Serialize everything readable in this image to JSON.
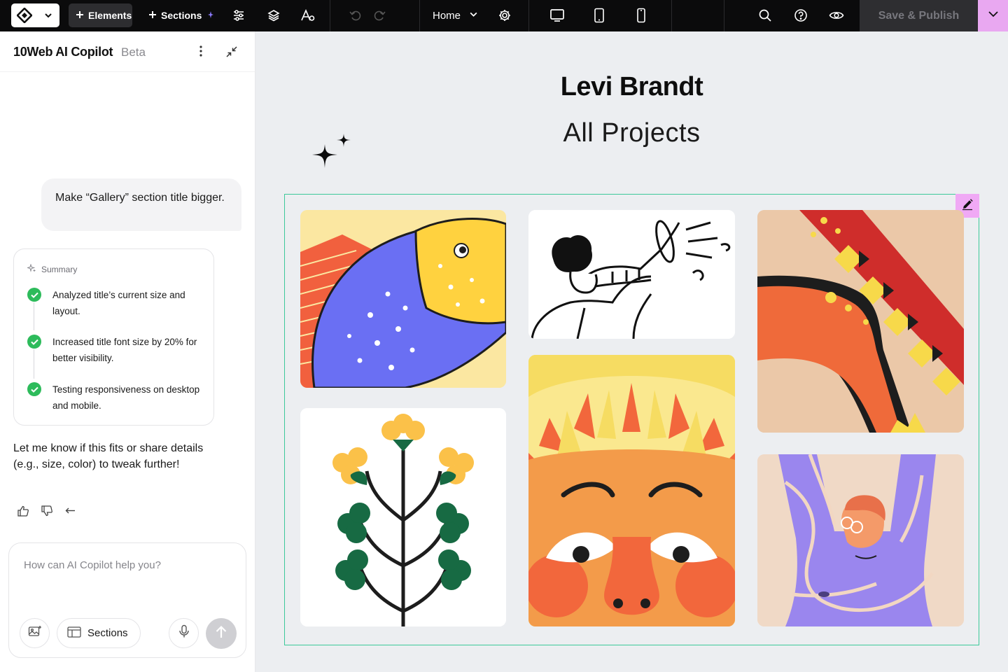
{
  "topbar": {
    "elements_label": "Elements",
    "sections_label": "Sections",
    "page_selector": "Home",
    "publish_label": "Save & Publish"
  },
  "sidebar": {
    "title": "10Web AI Copilot",
    "badge": "Beta",
    "user_message": "Make “Gallery” section title bigger.",
    "summary": {
      "heading": "Summary",
      "steps": [
        {
          "text": "Analyzed title’s current size and layout."
        },
        {
          "text": "Increased title font size by 20% for better visibility."
        },
        {
          "text": "Testing responsiveness on desktop and mobile."
        }
      ]
    },
    "followup": "Let me know if this fits or share details (e.g., size, color) to tweak further!",
    "composer": {
      "placeholder": "How can AI Copilot help you?",
      "sections_label": "Sections"
    }
  },
  "canvas": {
    "title": "Levi Brandt",
    "subtitle": "All Projects",
    "gallery_items": [
      {
        "name": "fish-illustration"
      },
      {
        "name": "trumpet-player-illustration"
      },
      {
        "name": "abstract-pattern-illustration"
      },
      {
        "name": "flower-plant-illustration"
      },
      {
        "name": "sun-face-illustration"
      },
      {
        "name": "person-arms-raised-illustration"
      }
    ]
  },
  "colors": {
    "topbar_bg": "#0b0b0c",
    "accent_pink": "#e9a8f1",
    "selection_green": "#3cc99a",
    "check_green": "#2dbb5b",
    "canvas_bg": "#eceef1"
  }
}
